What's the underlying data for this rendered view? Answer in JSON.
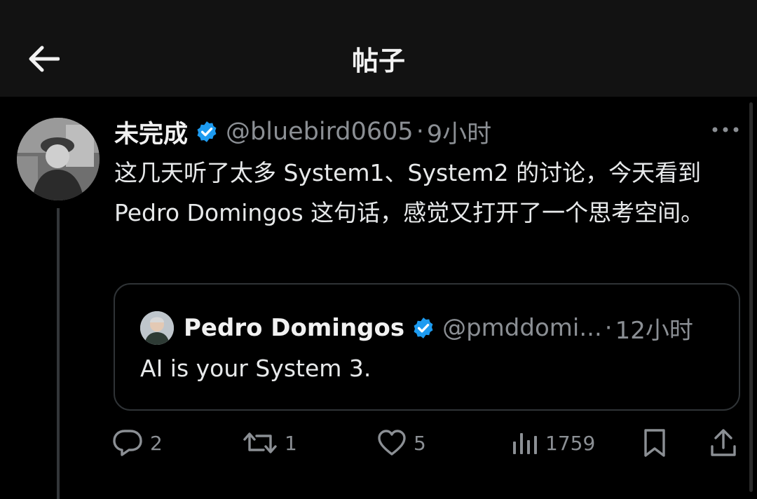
{
  "topbar": {
    "title": "帖子",
    "back_icon": "arrow-left-icon"
  },
  "tweet": {
    "author_name": "未完成",
    "handle": "@bluebird0605",
    "separator": "·",
    "time": "9小时",
    "text": "这几天听了太多 System1、System2 的讨论，今天看到 Pedro Domingos 这句话，感觉又打开了一个思考空间。"
  },
  "quote": {
    "author_name": "Pedro Domingos",
    "handle": "@pmddomi...",
    "separator": "·",
    "time": "12小时",
    "text": "AI is your System 3."
  },
  "actions": {
    "replies": "2",
    "retweets": "1",
    "likes": "5",
    "views": "1759"
  },
  "colors": {
    "background": "#000000",
    "topbar": "#121212",
    "verified": "#1d9bf0",
    "muted": "#8b8f94",
    "text": "#e7e9ea",
    "border": "#2f3336"
  }
}
